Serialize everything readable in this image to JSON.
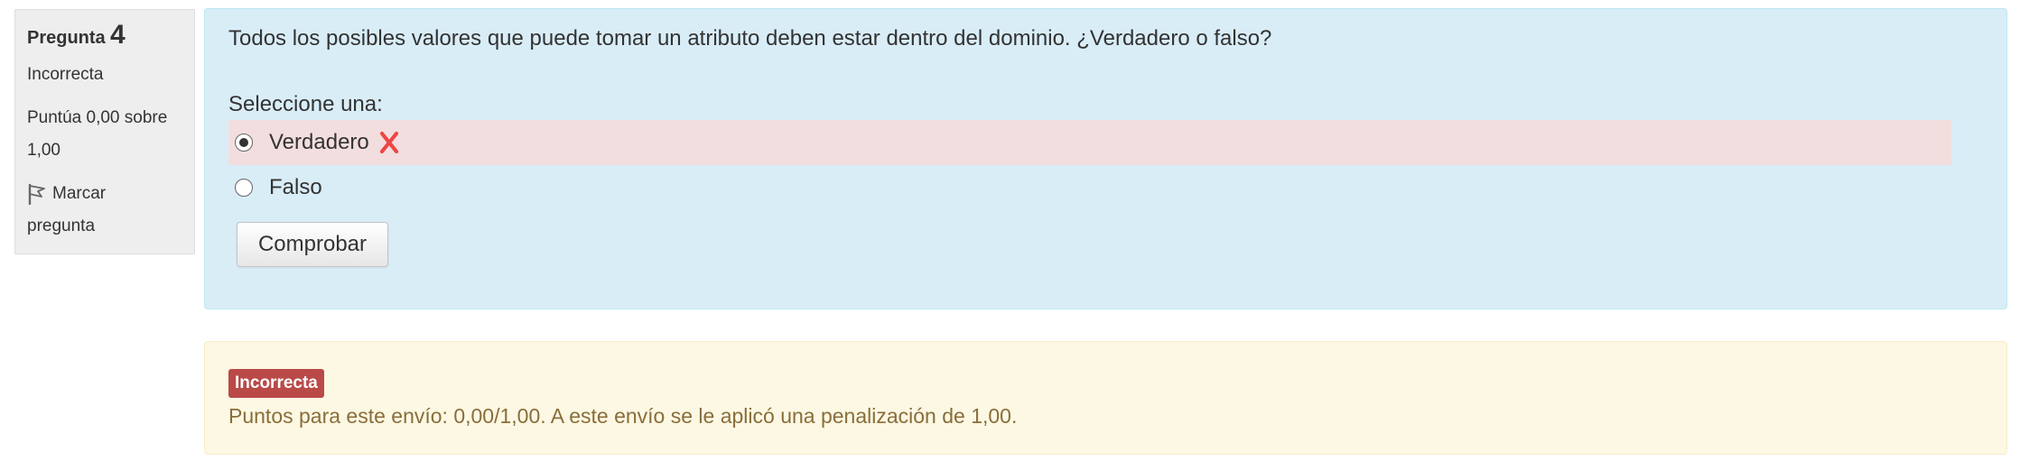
{
  "info": {
    "question_label": "Pregunta",
    "question_number": "4",
    "state": "Incorrecta",
    "grade_line1": "Puntúa 0,00 sobre",
    "grade_line2": "1,00",
    "flag_line1": "Marcar",
    "flag_line2": "pregunta",
    "flag_icon": "flag-icon"
  },
  "question": {
    "text": "Todos los posibles valores que puede tomar un atributo deben estar dentro del dominio. ¿Verdadero o falso?",
    "prompt": "Seleccione una:",
    "options": [
      {
        "label": "Verdadero",
        "selected": true,
        "status": "incorrect",
        "status_icon": "cross-icon"
      },
      {
        "label": "Falso",
        "selected": false
      }
    ],
    "check_button": "Comprobar"
  },
  "outcome": {
    "badge": "Incorrecta",
    "feedback": "Puntos para este envío: 0,00/1,00. A este envío se le aplicó una penalización de 1,00."
  },
  "colors": {
    "formulation_bg": "#d9edf7",
    "incorrect_row_bg": "#f2dede",
    "cross_icon": "#ef4545",
    "outcome_bg": "#fcf8e3",
    "badge_bg": "#b94a48",
    "feedback_text": "#8a6d3b"
  }
}
